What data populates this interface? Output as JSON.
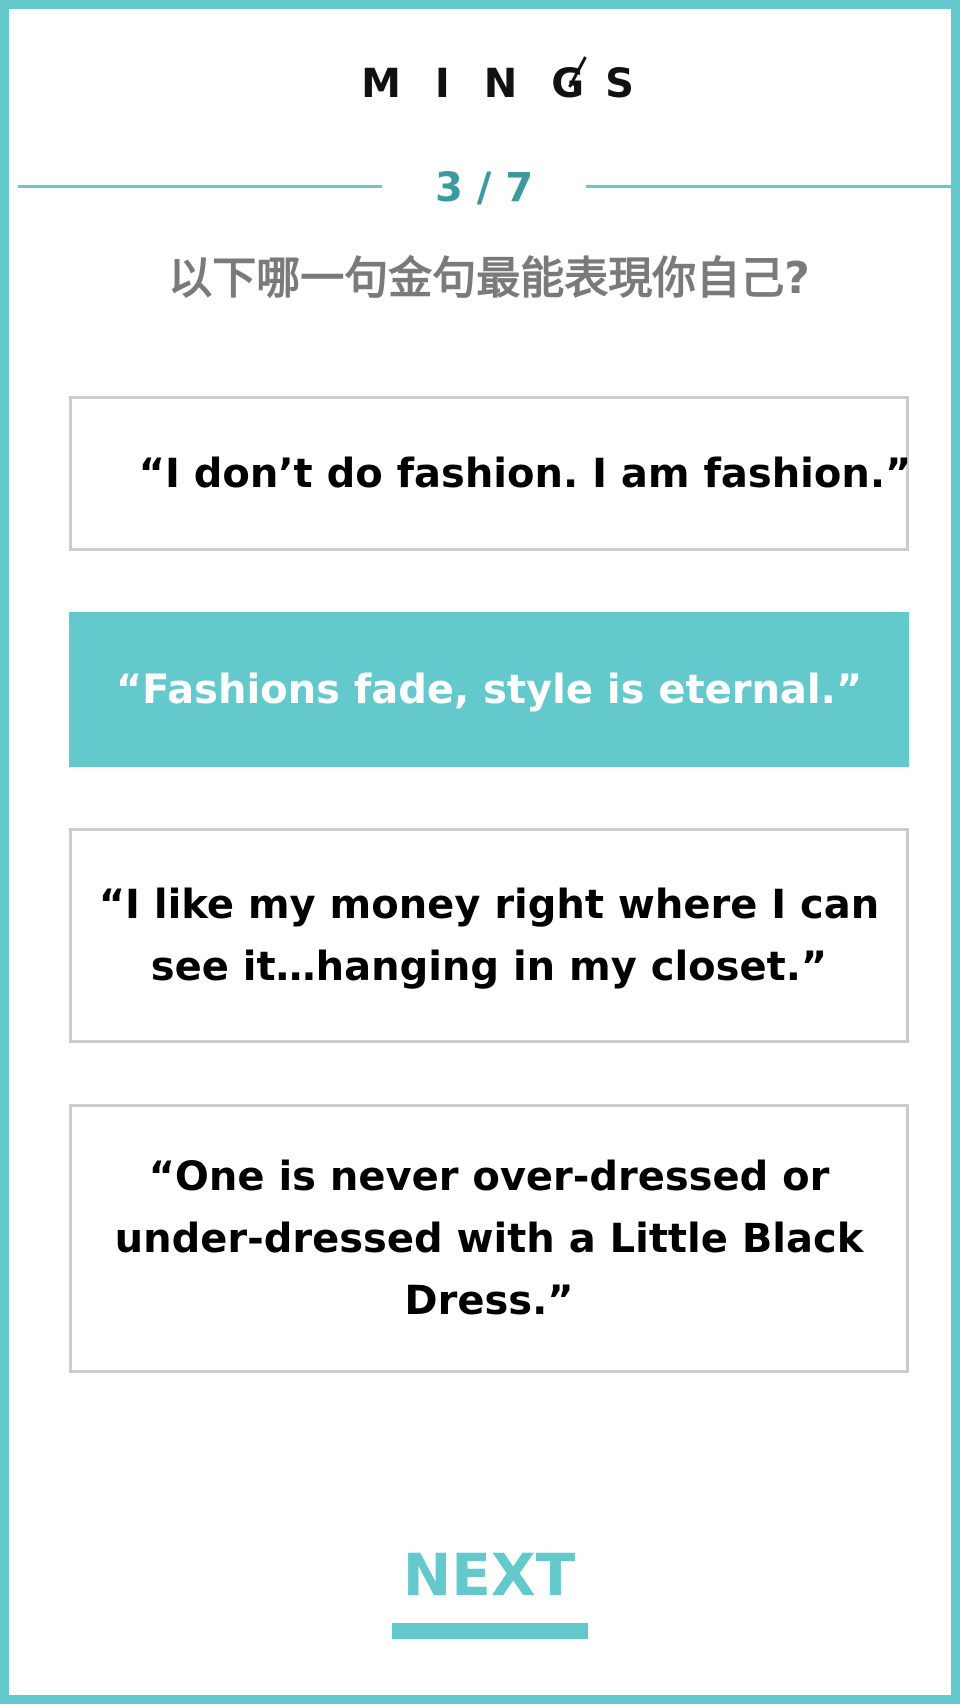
{
  "brand": {
    "logo_letters": [
      "M",
      "I",
      "N",
      "G"
    ],
    "logo_suffix": "S"
  },
  "progress": {
    "label": "3 / 7",
    "current": 3,
    "total": 7
  },
  "question": "以下哪一句金句最能表現你自己?",
  "options": [
    {
      "label": "“I don’t do fashion. I am fashion.”",
      "selected": false
    },
    {
      "label": "“Fashions fade, style is eternal.”",
      "selected": true
    },
    {
      "label": "“I like my money right where I can see it…hanging in my closet.”",
      "selected": false
    },
    {
      "label": "“One is never over-dressed or under-dressed with a Little Black Dress.”",
      "selected": false
    }
  ],
  "next_button": {
    "label": "NEXT"
  },
  "colors": {
    "accent": "#63c9cc",
    "progress_text": "#3c9a9e",
    "question_text": "#7a7a7a",
    "option_border": "#cccccc"
  }
}
